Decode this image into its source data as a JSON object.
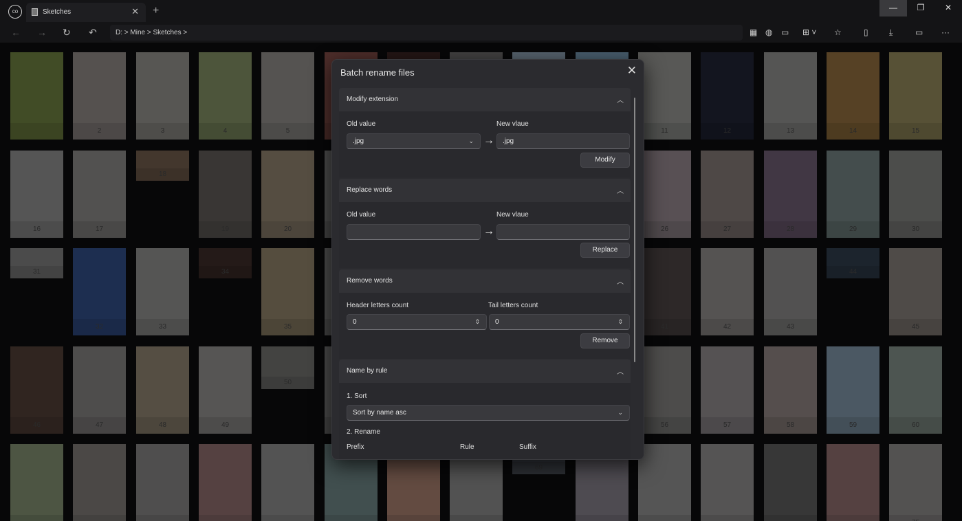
{
  "titlebar": {
    "tab_title": "Sketches",
    "new_tab": "+",
    "tab_close": "✕",
    "logo": "co",
    "window_controls": {
      "minimize": "—",
      "restore": "❐",
      "close": "✕"
    }
  },
  "toolbar": {
    "address": "D:  >  Mine  >  Sketches  >",
    "back": "←",
    "forward": "→",
    "refresh": "↻",
    "undo": "↶",
    "more": "···"
  },
  "icons": {
    "titlebar_logo": "cloud-logo-icon",
    "toolbar_right": [
      "grid-view-icon",
      "globe-icon",
      "folder-open-icon",
      "layout-icon",
      "star-icon",
      "clipboard-icon",
      "download-icon",
      "comment-icon",
      "more-icon"
    ]
  },
  "gallery": {
    "thumbs": [
      "",
      "2",
      "3",
      "4",
      "5",
      "",
      "",
      "",
      "",
      "",
      "11",
      "12",
      "13",
      "14",
      "15",
      "16",
      "17",
      "18",
      "19",
      "20",
      "",
      "",
      "",
      "",
      "",
      "26",
      "27",
      "28",
      "29",
      "30",
      "31",
      "32",
      "33",
      "34",
      "35",
      "",
      "",
      "",
      "",
      "",
      "41",
      "42",
      "43",
      "44",
      "45",
      "46",
      "47",
      "48",
      "49",
      "50",
      "",
      "",
      "",
      "",
      "",
      "56",
      "57",
      "58",
      "59",
      "60",
      "",
      "",
      "",
      "",
      "",
      "",
      "",
      "",
      "69",
      "",
      "",
      "",
      "",
      "",
      "75"
    ],
    "colors": [
      "#6a7b3e",
      "#8a8380",
      "#8d8b86",
      "#7c8a5f",
      "#8a8784",
      "#7d4a44",
      "#3a2422",
      "#6b6a6a",
      "#8c9fb0",
      "#7596b0",
      "#8e8f8b",
      "#1f2232",
      "#8a8988",
      "#8b6a3c",
      "#8d8457",
      "#8a8a8a",
      "#858381",
      "#6c5a4a",
      "#5d5855",
      "#8a7d6a",
      "#777",
      "#777",
      "#777",
      "#777",
      "#777",
      "#8e8288",
      "#7e7472",
      "#6a5a6f",
      "#6e7d7c",
      "#7b7c79",
      "#7a7a7a",
      "#2f4b82",
      "#8a8a88",
      "#3a2b28",
      "#8a7d65",
      "#777",
      "#777",
      "#777",
      "#777",
      "#777",
      "#4a4241",
      "#8a8685",
      "#858483",
      "#2e3a4a",
      "#807a74",
      "#4e3d35",
      "#7e7c7b",
      "#8a7f6c",
      "#8c8a88",
      "#6d6c6a",
      "#777",
      "#777",
      "#777",
      "#777",
      "#777",
      "#7c7b7a",
      "#8a8587",
      "#8a7f7c",
      "#7a8fa0",
      "#7d8a83",
      "#7c8a6c",
      "#7a7572",
      "#807f7e",
      "#8a6a6a",
      "#878787",
      "#6a8080",
      "#a07a6a",
      "#858585",
      "#50565e",
      "#7e7a84",
      "#8a8a8a",
      "#8a8888",
      "#5a5a5a",
      "#8a6a6a",
      "#878584"
    ]
  },
  "dialog": {
    "title": "Batch rename files",
    "close": "✕",
    "modify_extension": {
      "title": "Modify extension",
      "old_label": "Old value",
      "new_label": "New vlaue",
      "old_value": ".jpg",
      "new_value": ".jpg",
      "button": "Modify"
    },
    "replace_words": {
      "title": "Replace words",
      "old_label": "Old value",
      "new_label": "New vlaue",
      "old_value": "",
      "new_value": "",
      "button": "Replace"
    },
    "remove_words": {
      "title": "Remove words",
      "header_label": "Header letters count",
      "tail_label": "Tail letters count",
      "header_value": "0",
      "tail_value": "0",
      "button": "Remove"
    },
    "name_by_rule": {
      "title": "Name by rule",
      "step1": "1. Sort",
      "sort_value": "Sort by name asc",
      "step2": "2. Rename",
      "col_prefix": "Prefix",
      "col_rule": "Rule",
      "col_suffix": "Suffix"
    }
  }
}
